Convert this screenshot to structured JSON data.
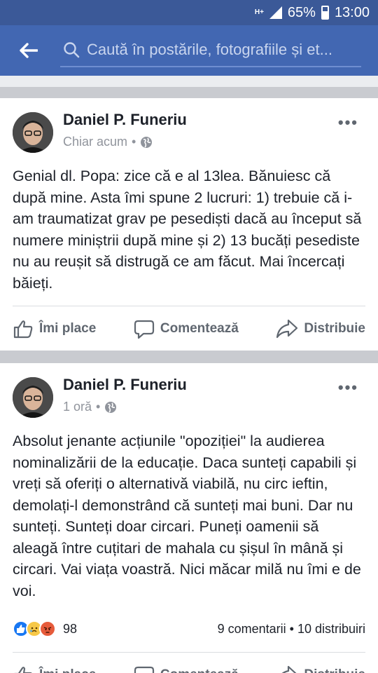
{
  "status_bar": {
    "network": "H+",
    "battery": "65%",
    "time": "13:00"
  },
  "search": {
    "placeholder": "Caută în postările, fotografiile și et..."
  },
  "actions": {
    "like": "Îmi place",
    "comment": "Comentează",
    "share": "Distribuie"
  },
  "posts": [
    {
      "author": "Daniel P. Funeriu",
      "time": "Chiar acum",
      "text": "Genial dl. Popa: zice că e al 13lea. Bănuiesc că după mine. Asta îmi spune 2 lucruri: 1) trebuie că i-am traumatizat grav pe pesediști dacă au început să numere miniștrii după mine și 2) 13 bucăți pesediste nu au reușit să distrugă ce am făcut. Mai încercați băieți."
    },
    {
      "author": "Daniel P. Funeriu",
      "time": "1 oră",
      "text": "Absolut jenante acțiunile \"opoziției\" la audierea nominalizării de la educație. Daca sunteți capabili și vreți să oferiți o alternativă viabilă, nu circ ieftin, demolați-l demonstrând că sunteți mai buni. Dar nu sunteți. Sunteți doar circari. Puneți oamenii să aleagă între cuțitari de mahala cu șișul în mână și circari. Vai viața voastră. Nici măcar milă nu îmi e de voi.",
      "reaction_count": "98",
      "comments": "9 comentarii",
      "shares": "10 distribuiri"
    }
  ]
}
